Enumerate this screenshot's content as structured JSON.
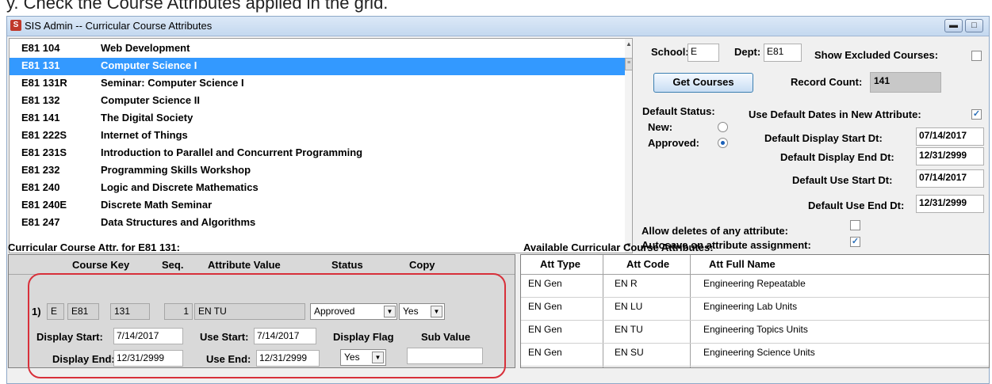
{
  "caption": "y. Check the Course Attributes applied in the grid.",
  "window": {
    "title": "SIS Admin -- Curricular Course Attributes",
    "min_label": "▬",
    "max_label": "□"
  },
  "courses": [
    {
      "key": "E81 104",
      "name": "Web Development"
    },
    {
      "key": "E81 131",
      "name": "Computer Science I"
    },
    {
      "key": "E81 131R",
      "name": "Seminar: Computer Science I"
    },
    {
      "key": "E81 132",
      "name": "Computer Science II"
    },
    {
      "key": "E81 141",
      "name": "The Digital Society"
    },
    {
      "key": "E81 222S",
      "name": "Internet of Things"
    },
    {
      "key": "E81 231S",
      "name": "Introduction to Parallel and Concurrent Programming"
    },
    {
      "key": "E81 232",
      "name": "Programming Skills Workshop"
    },
    {
      "key": "E81 240",
      "name": "Logic and Discrete Mathematics"
    },
    {
      "key": "E81 240E",
      "name": "Discrete Math Seminar"
    },
    {
      "key": "E81 247",
      "name": "Data Structures and Algorithms"
    }
  ],
  "selected_index": 1,
  "right": {
    "school_label": "School:",
    "school_value": "E",
    "dept_label": "Dept:",
    "dept_value": "E81",
    "show_excluded_label": "Show Excluded Courses:",
    "get_courses_label": "Get Courses",
    "record_count_label": "Record Count:",
    "record_count_value": "141",
    "default_status_label": "Default Status:",
    "new_label": "New:",
    "approved_label": "Approved:",
    "use_default_dates_label": "Use Default Dates in New Attribute:",
    "display_start_label": "Default Display Start Dt:",
    "display_start_value": "07/14/2017",
    "display_end_label": "Default Display End Dt:",
    "display_end_value": "12/31/2999",
    "use_start_label": "Default Use Start Dt:",
    "use_start_value": "07/14/2017",
    "use_end_label": "Default Use End Dt:",
    "use_end_value": "12/31/2999",
    "allow_deletes_label": "Allow deletes of any attribute:",
    "autosave_label": "Autosave on attribute assignment:",
    "check_mark": "✓"
  },
  "attr_panel": {
    "title": "Curricular Course Attr. for E81 131:",
    "headers": {
      "course_key": "Course Key",
      "seq": "Seq.",
      "attr_value": "Attribute Value",
      "status": "Status",
      "copy": "Copy"
    },
    "row": {
      "num": "1)",
      "school": "E",
      "dept": "E81",
      "course": "131",
      "seq": "1",
      "attr": "EN TU",
      "status": "Approved",
      "copy": "Yes",
      "display_start_label": "Display Start:",
      "display_start": "7/14/2017",
      "use_start_label": "Use Start:",
      "use_start": "7/14/2017",
      "display_flag_label": "Display Flag",
      "sub_value_label": "Sub Value",
      "display_end_label": "Display End:",
      "display_end": "12/31/2999",
      "use_end_label": "Use End:",
      "use_end": "12/31/2999",
      "display_flag": "Yes",
      "sub_value": ""
    }
  },
  "avail": {
    "title": "Available Curricular Course Attributes:",
    "headers": {
      "type": "Att Type",
      "code": "Att Code",
      "name": "Att Full Name"
    },
    "rows": [
      {
        "type": "EN Gen",
        "code": "EN R",
        "name": "Engineering Repeatable"
      },
      {
        "type": "EN Gen",
        "code": "EN LU",
        "name": "Engineering Lab Units"
      },
      {
        "type": "EN Gen",
        "code": "EN TU",
        "name": "Engineering Topics Units"
      },
      {
        "type": "EN Gen",
        "code": "EN SU",
        "name": "Engineering Science Units"
      }
    ]
  },
  "icons": {
    "dropdown": "▼",
    "scroll_up": "▲",
    "scroll_down": "▼",
    "grip": "≡",
    "app": "S"
  }
}
